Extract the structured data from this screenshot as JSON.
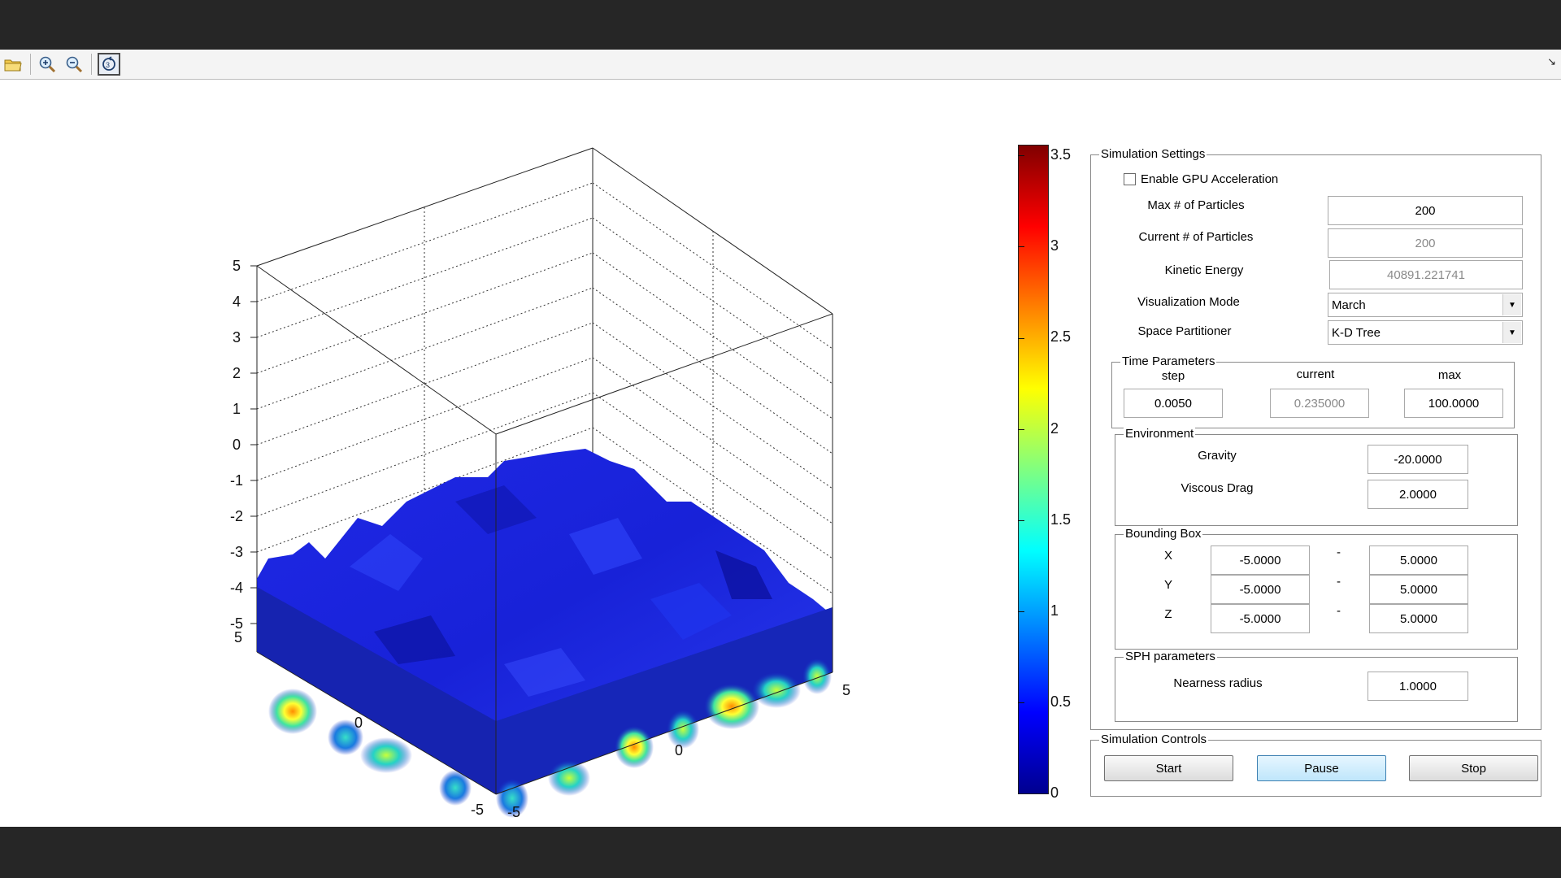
{
  "toolbar": {
    "open_icon": "folder-open-icon",
    "zoom_in_icon": "zoom-in-icon",
    "zoom_out_icon": "zoom-out-icon",
    "rotate_icon": "rotate-3d-icon",
    "corner_glyph": "↘"
  },
  "plot": {
    "type": "3d-surface",
    "z_ticks": [
      "5",
      "4",
      "3",
      "2",
      "1",
      "0",
      "-1",
      "-2",
      "-3",
      "-4",
      "-5"
    ],
    "x_ticks": [
      "5",
      "0",
      "-5"
    ],
    "y_ticks": [
      "-5",
      "0",
      "5"
    ],
    "xlim": [
      -5,
      5
    ],
    "ylim": [
      -5,
      5
    ],
    "zlim": [
      -5,
      5
    ],
    "grid": true
  },
  "colorbar": {
    "labels": [
      "3.5",
      "3",
      "2.5",
      "2",
      "1.5",
      "1",
      "0.5",
      "0"
    ],
    "range": [
      0,
      3.5
    ],
    "colormap": "jet"
  },
  "settings": {
    "title": "Simulation Settings",
    "gpu_label": "Enable GPU Acceleration",
    "gpu_checked": false,
    "max_particles_label": "Max # of Particles",
    "max_particles": "200",
    "current_particles_label": "Current # of Particles",
    "current_particles": "200",
    "kinetic_energy_label": "Kinetic Energy",
    "kinetic_energy": "40891.221741",
    "vis_mode_label": "Visualization Mode",
    "vis_mode": "March",
    "space_part_label": "Space Partitioner",
    "space_part": "K-D Tree"
  },
  "time": {
    "title": "Time Parameters",
    "step_label": "step",
    "current_label": "current",
    "max_label": "max",
    "step": "0.0050",
    "current": "0.235000",
    "max": "100.0000"
  },
  "environment": {
    "title": "Environment",
    "gravity_label": "Gravity",
    "gravity": "-20.0000",
    "drag_label": "Viscous Drag",
    "drag": "2.0000"
  },
  "bbox": {
    "title": "Bounding Box",
    "sep": "-",
    "rows": [
      {
        "label": "X",
        "min": "-5.0000",
        "max": "5.0000"
      },
      {
        "label": "Y",
        "min": "-5.0000",
        "max": "5.0000"
      },
      {
        "label": "Z",
        "min": "-5.0000",
        "max": "5.0000"
      }
    ]
  },
  "sph": {
    "title": "SPH parameters",
    "radius_label": "Nearness radius",
    "radius": "1.0000"
  },
  "controls": {
    "title": "Simulation Controls",
    "start": "Start",
    "pause": "Pause",
    "stop": "Stop"
  }
}
